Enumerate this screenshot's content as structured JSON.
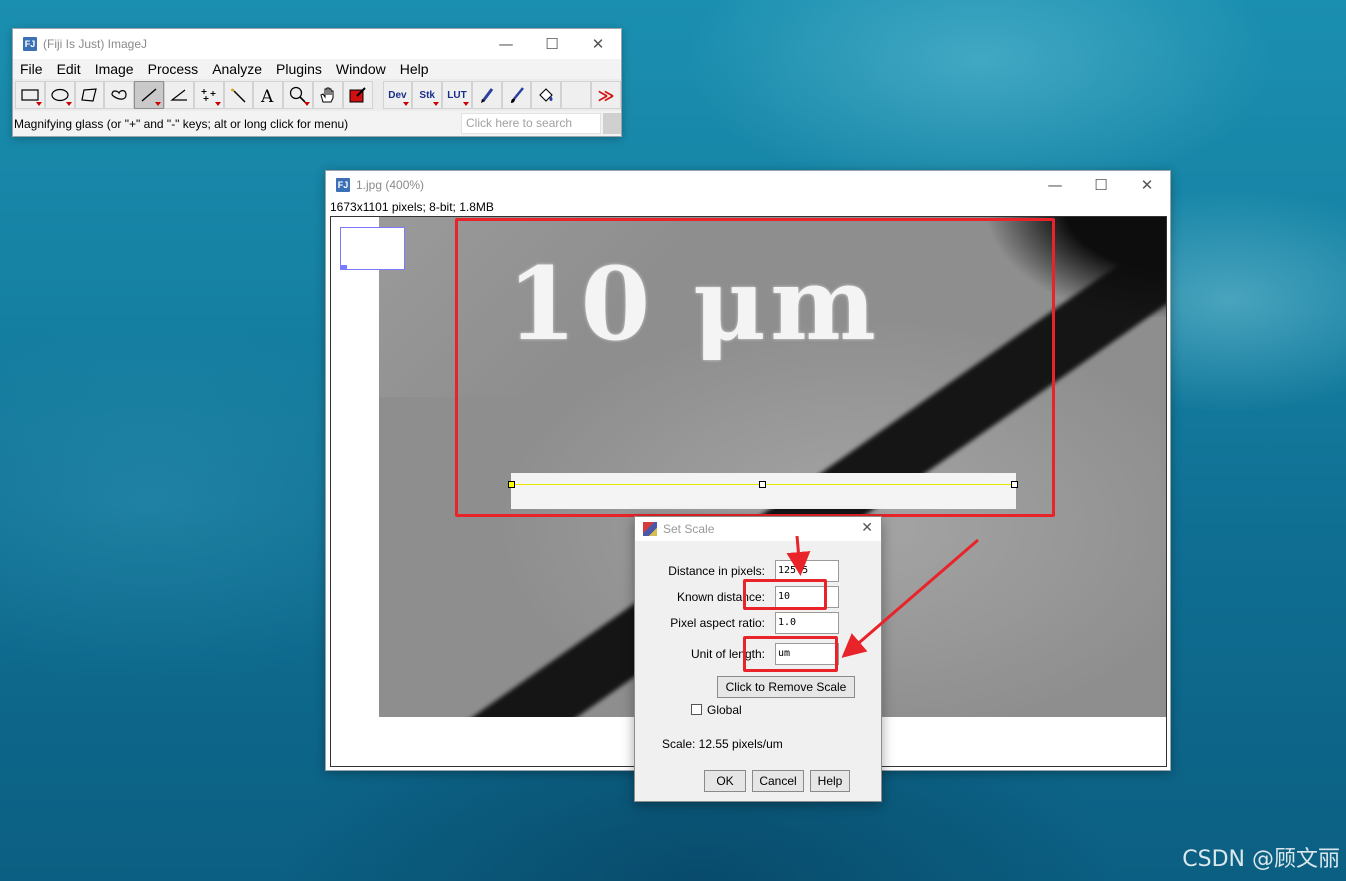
{
  "main_window": {
    "title": "(Fiji Is Just) ImageJ",
    "icon_label": "FJ",
    "controls": [
      "—",
      "☐",
      "✕"
    ],
    "menus": [
      "File",
      "Edit",
      "Image",
      "Process",
      "Analyze",
      "Plugins",
      "Window",
      "Help"
    ],
    "tools": [
      "rectangle-tool",
      "oval-tool",
      "polygon-tool",
      "freehand-tool",
      "line-tool",
      "angle-tool",
      "point-tool",
      "wand-tool",
      "text-tool",
      "magnifying-glass-tool",
      "scrolling-tool",
      "color-picker-tool"
    ],
    "extra_tools": [
      "Dev",
      "Stk",
      "LUT"
    ],
    "more_symbol": "≫",
    "status_text": "Magnifying glass (or \"+\" and \"-\" keys; alt or long click for menu)",
    "search_placeholder": "Click here to search"
  },
  "image_window": {
    "title": "1.jpg (400%)",
    "info": "1673x1101 pixels; 8-bit; 1.8MB",
    "scale_label": "10 μm"
  },
  "dialog": {
    "title": "Set Scale",
    "close": "✕",
    "fields": [
      {
        "label": "Distance in pixels:",
        "value": "125.5"
      },
      {
        "label": "Known distance:",
        "value": "10"
      },
      {
        "label": "Pixel aspect ratio:",
        "value": "1.0"
      },
      {
        "label": "Unit of length:",
        "value": "um"
      }
    ],
    "remove_scale_button": "Click to Remove Scale",
    "global_label": "Global",
    "scale_text": "Scale: 12.55 pixels/um",
    "ok_button": "OK",
    "cancel_button": "Cancel",
    "help_button": "Help"
  },
  "watermark": "CSDN @顾文丽",
  "colors": {
    "annotation_red": "#e8242a",
    "selection_yellow": "#e8e800",
    "desktop_teal": "#1580a2"
  }
}
